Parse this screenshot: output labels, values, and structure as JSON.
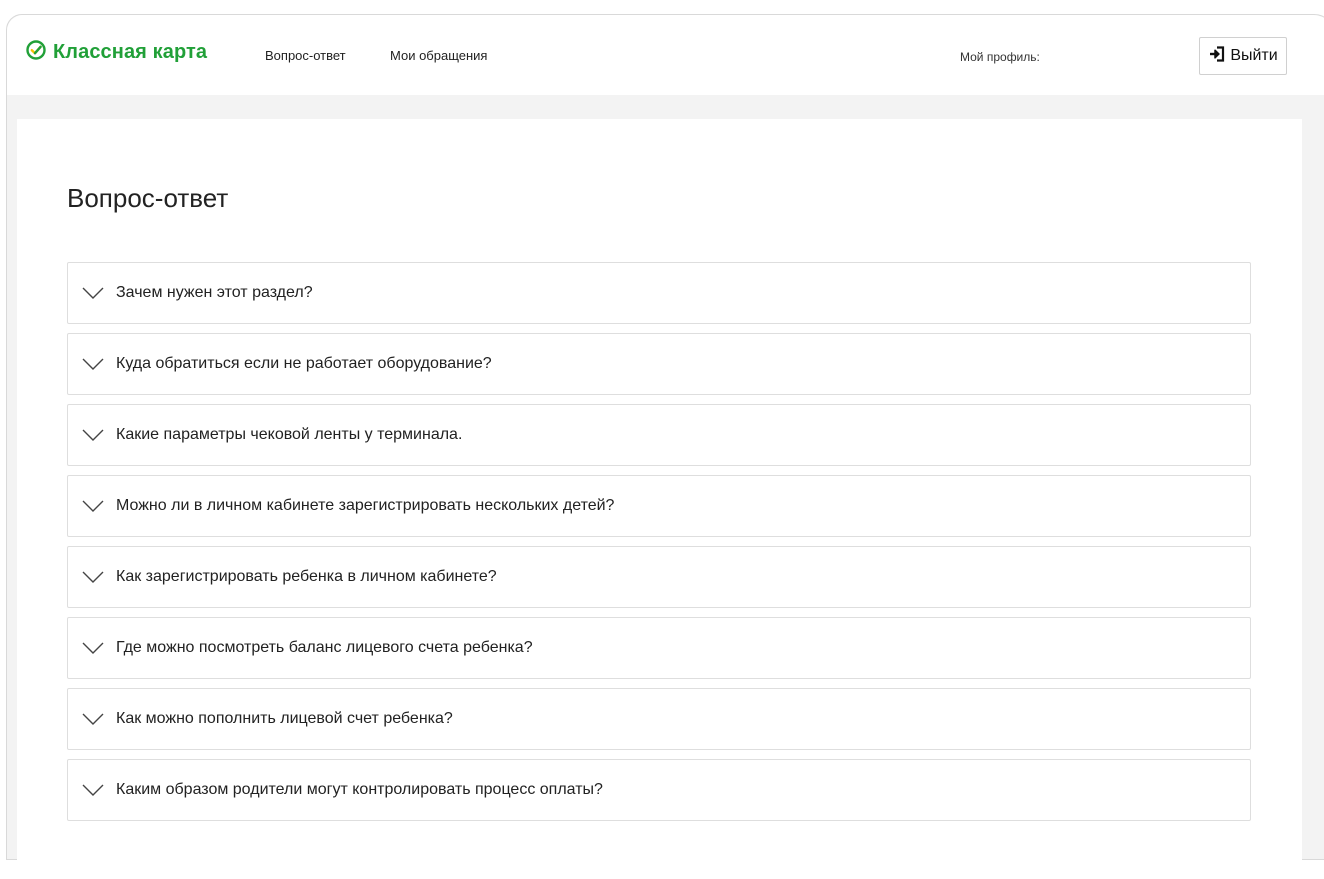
{
  "header": {
    "logo_text": "Классная карта",
    "nav": [
      {
        "label": "Вопрос-ответ"
      },
      {
        "label": "Мои обращения"
      }
    ],
    "profile_label": "Мой профиль:",
    "logout_label": "Выйти"
  },
  "main": {
    "title": "Вопрос-ответ",
    "faq": [
      {
        "question": "Зачем нужен этот раздел?"
      },
      {
        "question": "Куда обратиться если не работает оборудование?"
      },
      {
        "question": "Какие параметры чековой ленты у терминала."
      },
      {
        "question": "Можно ли в личном кабинете зарегистрировать нескольких детей?"
      },
      {
        "question": "Как зарегистрировать ребенка в личном кабинете?"
      },
      {
        "question": "Где можно посмотреть баланс лицевого счета ребенка?"
      },
      {
        "question": "Как можно пополнить лицевой счет ребенка?"
      },
      {
        "question": "Каким образом родители могут контролировать процесс оплаты?"
      }
    ]
  },
  "colors": {
    "brand": "#21a038",
    "page_bg": "#f3f3f3",
    "border": "#dedede"
  },
  "icons": {
    "logo": "check-circle-icon",
    "logout": "sign-in-arrow-icon",
    "faq_toggle": "chevron-down-icon"
  }
}
